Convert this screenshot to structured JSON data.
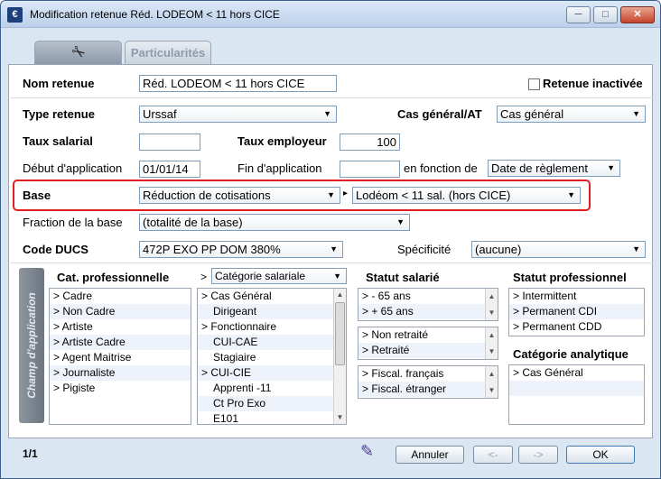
{
  "window": {
    "icon_glyph": "€",
    "title": "Modification retenue Réd. LODEOM < 11 hors CICE",
    "min": "─",
    "max": "□",
    "close": "✕"
  },
  "tabs": {
    "tools_icon": "tools-icon",
    "particularites": "Particularités"
  },
  "form": {
    "nom_retenue_label": "Nom retenue",
    "nom_retenue_value": "Réd. LODEOM < 11 hors CICE",
    "retenue_inactive_label": "Retenue inactivée",
    "type_retenue_label": "Type retenue",
    "type_retenue_value": "Urssaf",
    "cas_general_label": "Cas général/AT",
    "cas_general_value": "Cas général",
    "taux_salarial_label": "Taux salarial",
    "taux_salarial_value": "",
    "taux_employeur_label": "Taux employeur",
    "taux_employeur_value": "100",
    "debut_label": "Début d'application",
    "debut_value": "01/01/14",
    "fin_label": "Fin d'application",
    "fin_value": "",
    "en_fonction_label": "en fonction de",
    "en_fonction_value": "Date de règlement",
    "base_label": "Base",
    "base_value": "Réduction de cotisations",
    "base_sep": "▸",
    "base_detail_value": "Lodéom < 11 sal. (hors CICE)",
    "fraction_label": "Fraction de la base",
    "fraction_value": "(totalité de la base)",
    "code_ducs_label": "Code DUCS",
    "code_ducs_value": "472P   EXO PP DOM 380%",
    "specificite_label": "Spécificité",
    "specificite_value": "(aucune)"
  },
  "scope": {
    "vtab_label": "Champ d'application",
    "cat_pro": {
      "header": "Cat. professionnelle",
      "items": [
        "> Cadre",
        "> Non Cadre",
        "> Artiste",
        "> Artiste Cadre",
        "> Agent Maitrise",
        "> Journaliste",
        "> Pigiste"
      ]
    },
    "cat_sal": {
      "prefix": ">",
      "dropdown": "Catégorie salariale",
      "items": [
        "> Cas Général",
        "Dirigeant",
        "> Fonctionnaire",
        "CUI-CAE",
        "Stagiaire",
        "> CUI-CIE",
        "Apprenti -11",
        "Ct Pro Exo",
        "E101"
      ]
    },
    "statut_salarie": {
      "header": "Statut salarié",
      "group1": [
        ">  - 65 ans",
        ">  + 65 ans"
      ],
      "group2": [
        "> Non retraité",
        "> Retraité"
      ],
      "group3": [
        "> Fiscal. français",
        "> Fiscal. étranger"
      ]
    },
    "statut_pro": {
      "header": "Statut professionnel",
      "items": [
        "> Intermittent",
        "> Permanent CDI",
        "> Permanent CDD"
      ]
    },
    "cat_analytique": {
      "header": "Catégorie analytique",
      "items": [
        "> Cas Général"
      ]
    }
  },
  "footer": {
    "page": "1/1",
    "annuler": "Annuler",
    "prev": "<-",
    "next": "->",
    "ok": "OK"
  },
  "colors": {
    "accent": "#e02020",
    "title_bg": "#bcd0ea",
    "window_bg": "#dbe6f3"
  }
}
